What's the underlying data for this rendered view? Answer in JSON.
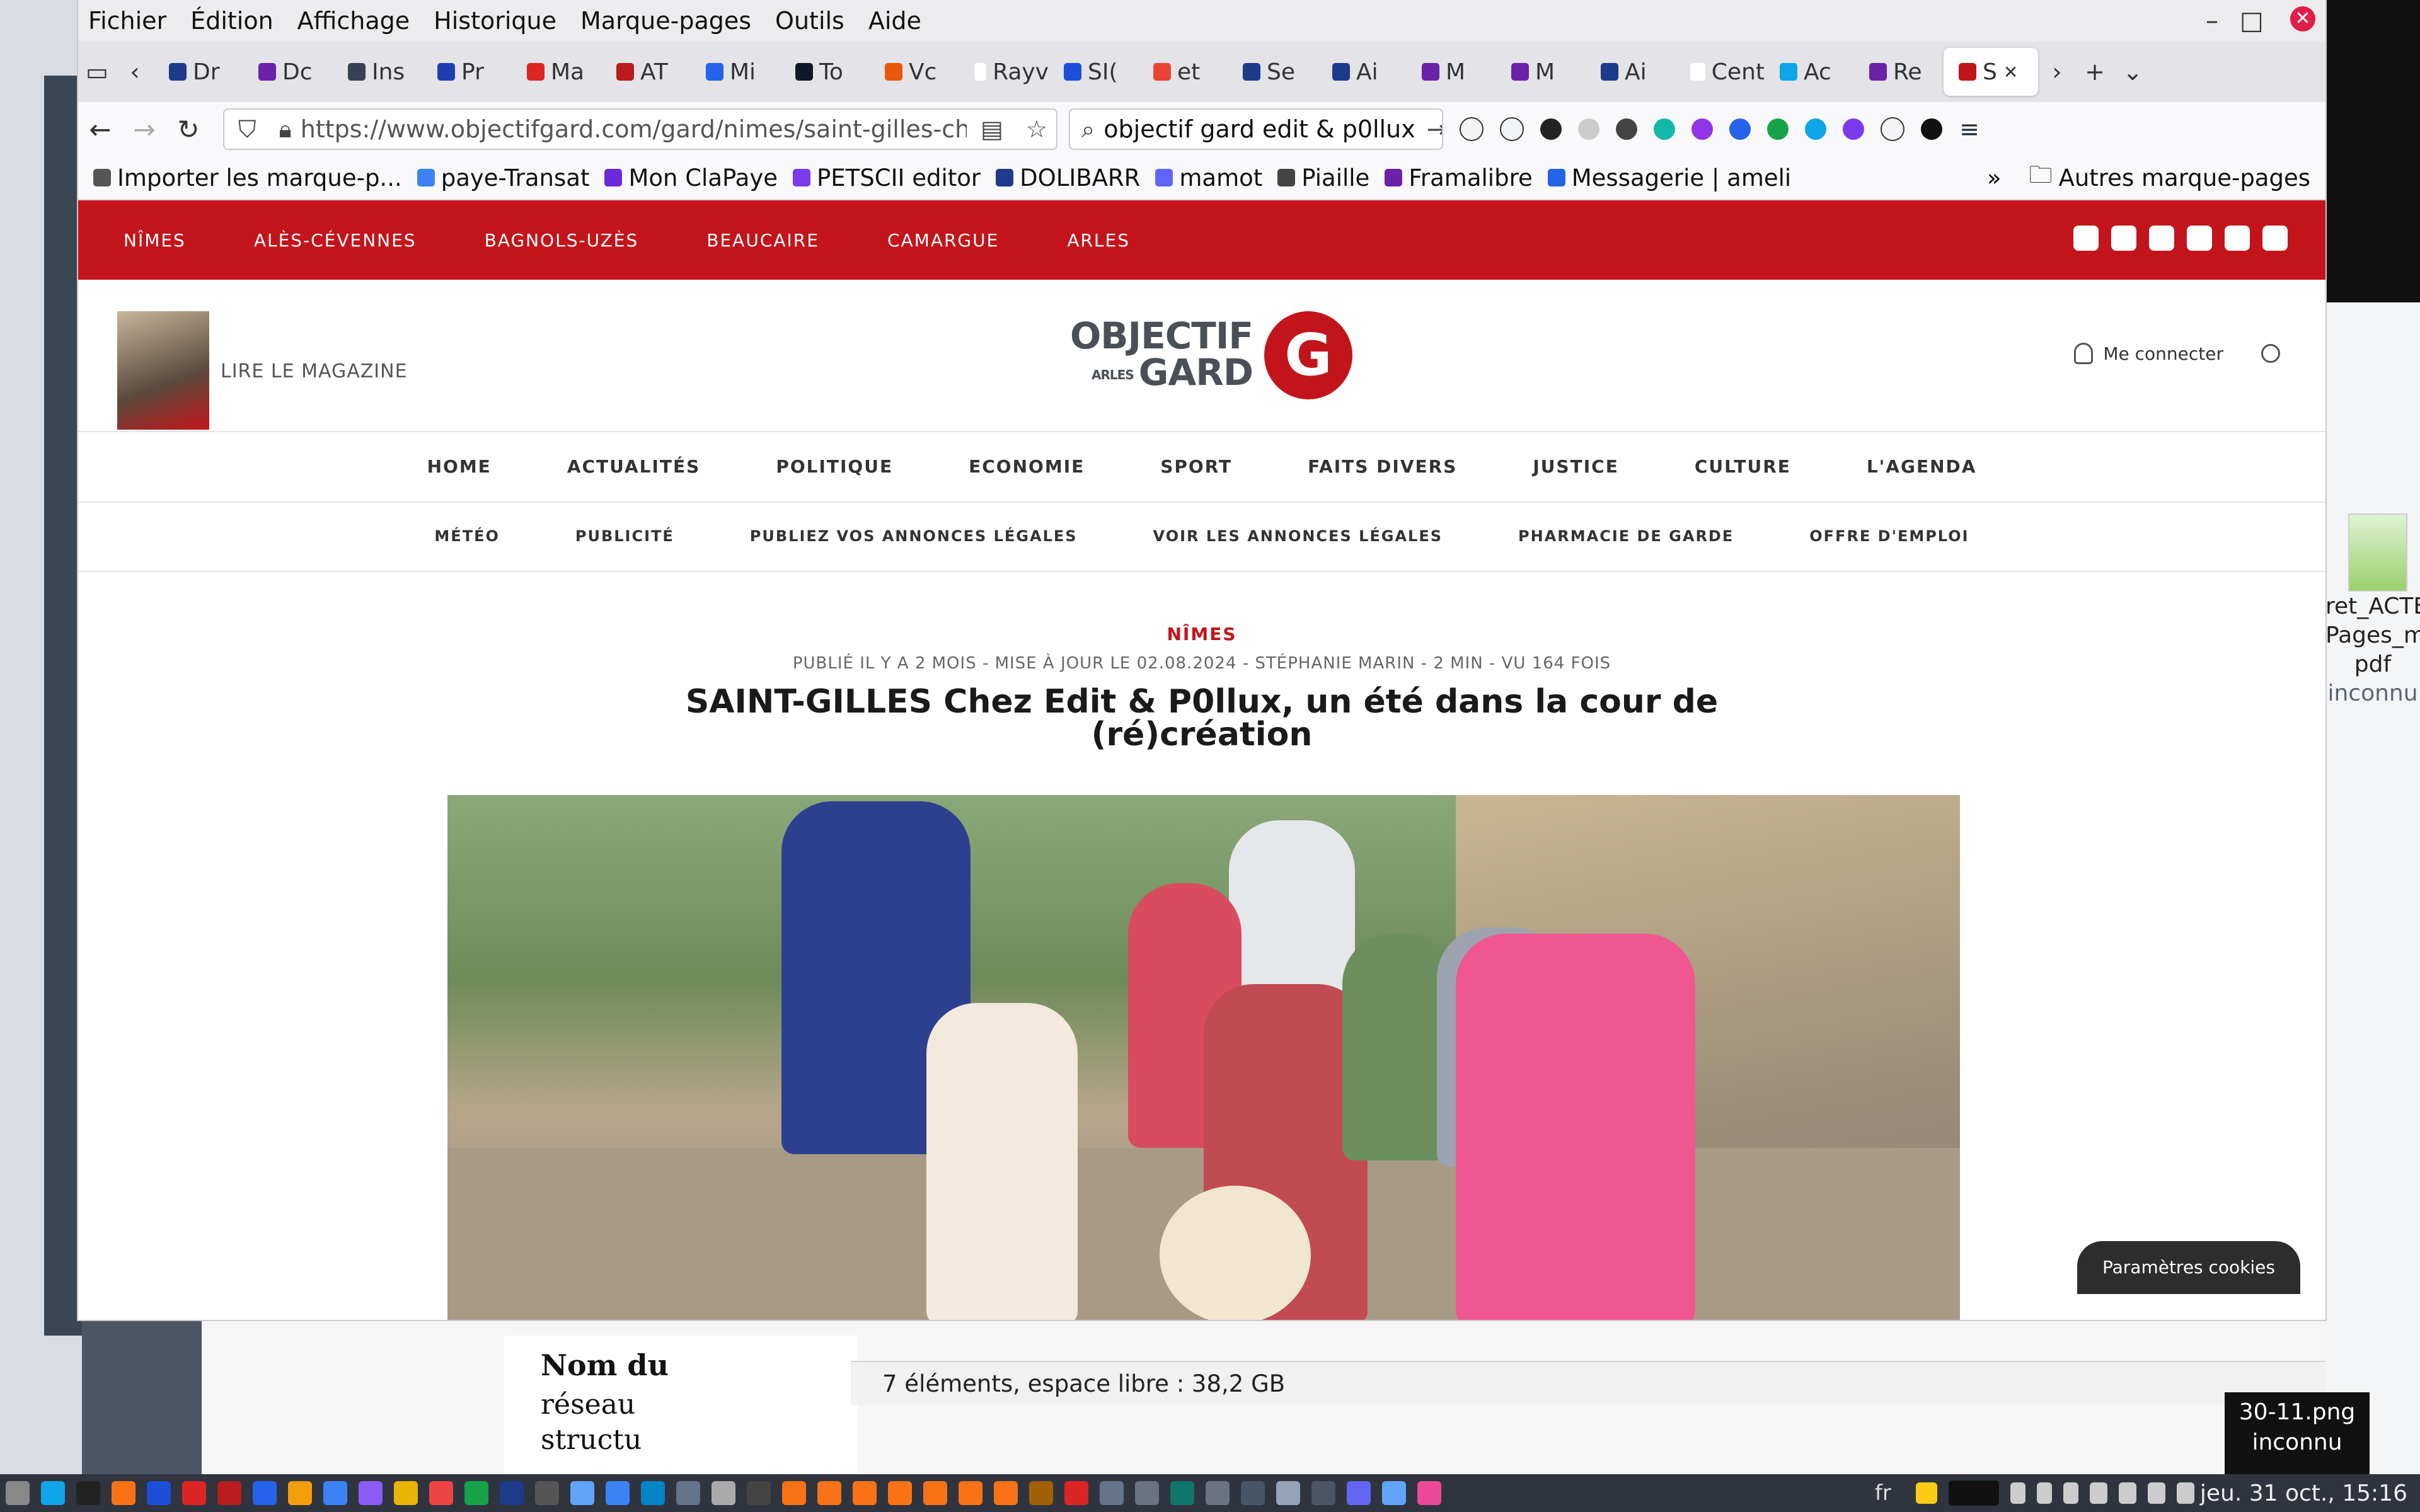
{
  "menubar": {
    "items": [
      "Fichier",
      "Édition",
      "Affichage",
      "Historique",
      "Marque-pages",
      "Outils",
      "Aide"
    ]
  },
  "tabs": [
    {
      "label": "Dr",
      "color": "#1e3a8a"
    },
    {
      "label": "Dc",
      "color": "#6b21a8"
    },
    {
      "label": "Ins",
      "color": "#374151"
    },
    {
      "label": "Pr",
      "color": "#1e40af"
    },
    {
      "label": "Ma",
      "color": "#dc2626"
    },
    {
      "label": "AT",
      "color": "#b91c1c"
    },
    {
      "label": "Mi",
      "color": "#2563eb"
    },
    {
      "label": "To",
      "color": "#111827"
    },
    {
      "label": "Vc",
      "color": "#ea580c"
    },
    {
      "label": "Rayv",
      "color": "#ffffff"
    },
    {
      "label": "SI(",
      "color": "#1d4ed8"
    },
    {
      "label": "et",
      "color": "#ea4335"
    },
    {
      "label": "Se",
      "color": "#1e3a8a"
    },
    {
      "label": "Ai",
      "color": "#1e3a8a"
    },
    {
      "label": "M",
      "color": "#6b21a8"
    },
    {
      "label": "M",
      "color": "#6b21a8"
    },
    {
      "label": "Ai",
      "color": "#1e3a8a"
    },
    {
      "label": "Cent",
      "color": "#ffffff"
    },
    {
      "label": "Ac",
      "color": "#0ea5e9"
    },
    {
      "label": "Re",
      "color": "#6b21a8"
    },
    {
      "label": "S",
      "color": "#c4141b",
      "active": true
    }
  ],
  "navbar": {
    "url": "https://www.objectifgard.com/gard/nimes/saint-gilles-chez-edit",
    "search": "objectif gard edit & p0llux"
  },
  "bookmarks": [
    {
      "label": "Importer les marque-p...",
      "color": "#555555"
    },
    {
      "label": "paye-Transat",
      "color": "#3b82f6"
    },
    {
      "label": "Mon ClaPaye",
      "color": "#6d28d9"
    },
    {
      "label": "PETSCII editor",
      "color": "#7c3aed"
    },
    {
      "label": "DOLIBARR",
      "color": "#1e3a8a"
    },
    {
      "label": "mamot",
      "color": "#6364ff"
    },
    {
      "label": "Piaille",
      "color": "#444444"
    },
    {
      "label": "Framalibre",
      "color": "#6b21a8"
    },
    {
      "label": "Messagerie | ameli",
      "color": "#2563eb"
    }
  ],
  "bookmarks_other": "Autres marque-pages",
  "site": {
    "cities": [
      "NÎMES",
      "ALÈS-CÉVENNES",
      "BAGNOLS-UZÈS",
      "BEAUCAIRE",
      "CAMARGUE",
      "ARLES"
    ],
    "read_magazine": "LIRE LE MAGAZINE",
    "logo_word1": "OBJECTIF",
    "logo_word2": "GARD",
    "logo_arles": "ARLES",
    "logo_mark": "G",
    "login": "Me connecter",
    "main_nav": [
      "HOME",
      "ACTUALITÉS",
      "POLITIQUE",
      "ECONOMIE",
      "SPORT",
      "FAITS DIVERS",
      "JUSTICE",
      "CULTURE",
      "L'AGENDA"
    ],
    "sub_nav": [
      "MÉTÉO",
      "PUBLICITÉ",
      "PUBLIEZ VOS ANNONCES LÉGALES",
      "VOIR LES ANNONCES LÉGALES",
      "PHARMACIE DE GARDE",
      "OFFRE D'EMPLOI"
    ],
    "brand_color": "#c4141b"
  },
  "article": {
    "category": "NÎMES",
    "meta": "PUBLIÉ IL Y A 2 MOIS - MISE À JOUR LE 02.08.2024 - STÉPHANIE MARIN - 2 MIN  - VU 164 FOIS",
    "title": "SAINT-GILLES Chez Edit & P0llux, un été dans la cour de (ré)création"
  },
  "cookie_button": "Paramètres cookies",
  "background": {
    "file_status": "7 éléments, espace libre : 38,2 GB",
    "doc_title": "Nom du",
    "doc_line1": "réseau",
    "doc_line2": "structu",
    "right_file": "ret_ACTE Pages_m pdf",
    "right_file_sub": "inconnu",
    "bottom_file": "30-11.png",
    "bottom_file_sub": "inconnu"
  },
  "taskbar": {
    "lang": "fr",
    "clock": "jeu. 31 oct., 15:16"
  }
}
